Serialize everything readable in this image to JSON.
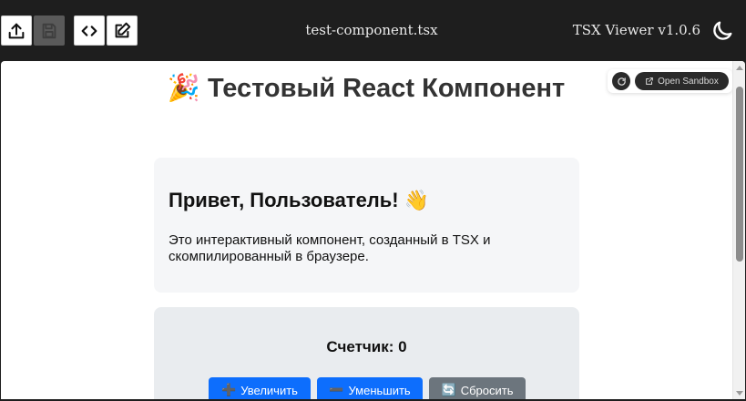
{
  "toolbar": {
    "buttons": [
      {
        "name": "upload-button",
        "icon": "upload-icon",
        "disabled": false
      },
      {
        "name": "save-button",
        "icon": "save-icon",
        "disabled": true
      },
      {
        "name": "code-view-button",
        "icon": "code-icon",
        "disabled": false
      },
      {
        "name": "edit-button",
        "icon": "edit-icon",
        "disabled": false
      }
    ],
    "filename": "test-component.tsx",
    "version": "TSX Viewer v1.0.6",
    "theme_icon": "moon-icon"
  },
  "sandbox": {
    "refresh_icon": "refresh-icon",
    "open_icon": "external-link-icon",
    "open_label": "Open Sandbox"
  },
  "content": {
    "title_emoji": "🎉",
    "title": "Тестовый React Компонент",
    "greeting": {
      "title": "Привет, Пользователь!",
      "title_emoji": "👋",
      "text": "Это интерактивный компонент, созданный в TSX и скомпилированный в браузере."
    },
    "counter": {
      "label": "Счетчик: 0",
      "increment_icon": "➕",
      "increment_label": "Увеличить",
      "decrement_icon": "➖",
      "decrement_label": "Уменьшить",
      "reset_icon": "🔄",
      "reset_label": "Сбросить"
    }
  },
  "colors": {
    "topbar": "#1e1e1e",
    "primary_button": "#0d6efd",
    "secondary_button": "#6c757d"
  }
}
